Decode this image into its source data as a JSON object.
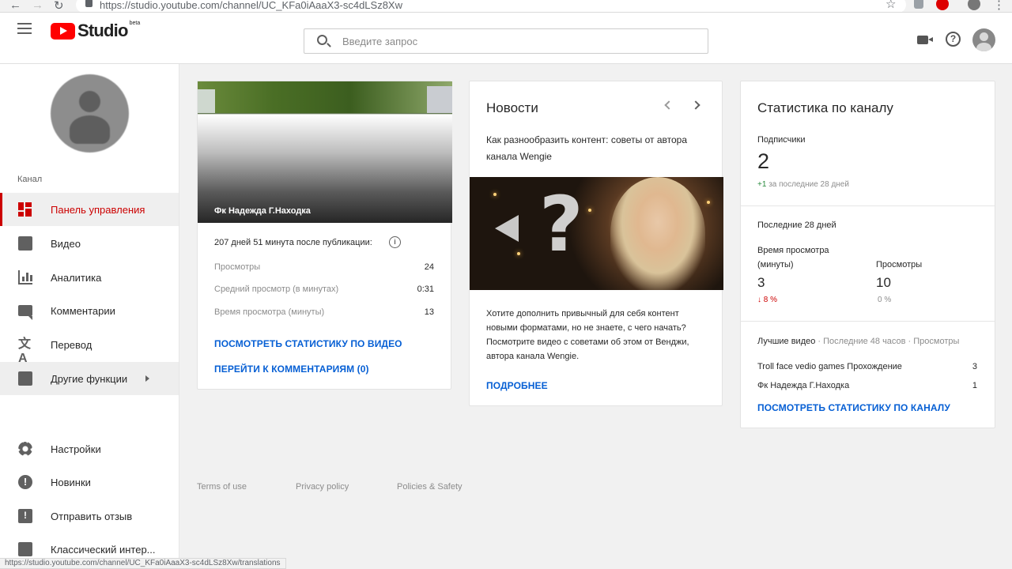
{
  "browser": {
    "url": "https://studio.youtube.com/channel/UC_KFa0iAaaX3-sc4dLSz8Xw",
    "status_url": "https://studio.youtube.com/channel/UC_KFa0iAaaX3-sc4dLSz8Xw/translations"
  },
  "header": {
    "logo_text": "Studio",
    "logo_badge": "beta",
    "search_placeholder": "Введите запрос"
  },
  "sidebar": {
    "section_label": "Канал",
    "items": [
      {
        "label": "Панель управления",
        "icon": "dashboard-icon",
        "active": true
      },
      {
        "label": "Видео",
        "icon": "video-library-icon"
      },
      {
        "label": "Аналитика",
        "icon": "analytics-icon"
      },
      {
        "label": "Комментарии",
        "icon": "comments-icon"
      },
      {
        "label": "Перевод",
        "icon": "translate-icon"
      },
      {
        "label": "Другие функции",
        "icon": "other-features-icon"
      }
    ],
    "bottom_items": [
      {
        "label": "Настройки",
        "icon": "settings-icon"
      },
      {
        "label": "Новинки",
        "icon": "whats-new-icon"
      },
      {
        "label": "Отправить отзыв",
        "icon": "feedback-icon"
      },
      {
        "label": "Классический интер...",
        "icon": "classic-studio-icon"
      }
    ]
  },
  "video_card": {
    "title": "Фк Надежда Г.Находка",
    "published": "207 дней 51 минута после публикации:",
    "stats": [
      {
        "label": "Просмотры",
        "value": "24"
      },
      {
        "label": "Средний просмотр (в минутах)",
        "value": "0:31"
      },
      {
        "label": "Время просмотра (минуты)",
        "value": "13"
      }
    ],
    "link_stats": "ПОСМОТРЕТЬ СТАТИСТИКУ ПО ВИДЕО",
    "link_comments": "ПЕРЕЙТИ К КОММЕНТАРИЯМ (0)"
  },
  "news_card": {
    "title": "Новости",
    "headline": "Как разнообразить контент: советы от автора канала Wengie",
    "body": "Хотите дополнить привычный для себя контент новыми форматами, но не знаете, с чего начать? Посмотрите видео с советами об этом от Венджи, автора канала Wengie.",
    "link_more": "ПОДРОБНЕЕ"
  },
  "stats_card": {
    "title": "Статистика по каналу",
    "subscribers_label": "Подписчики",
    "subscribers_value": "2",
    "subscribers_change": "+1",
    "subscribers_change_period": "за последние 28 дней",
    "period_label": "Последние 28 дней",
    "watch_time_label_1": "Время просмотра",
    "watch_time_label_2": "(минуты)",
    "watch_time_value": "3",
    "watch_time_change": "8 %",
    "views_label": "Просмотры",
    "views_value": "10",
    "views_change": "0 %",
    "top_videos_label": "Лучшие видео",
    "top_videos_sub": "· Последние 48 часов · Просмотры",
    "top_videos": [
      {
        "title": "Troll face vedio games Прохождение",
        "views": "3"
      },
      {
        "title": "Фк Надежда Г.Находка",
        "views": "1"
      }
    ],
    "link_channel_stats": "ПОСМОТРЕТЬ СТАТИСТИКУ ПО КАНАЛУ"
  },
  "footer": {
    "terms": "Terms of use",
    "privacy": "Privacy policy",
    "policies": "Policies & Safety"
  },
  "colors": {
    "brand_red": "#ff0000",
    "active_red": "#cc0000",
    "link_blue": "#065fd4",
    "positive_green": "#2b8a3e"
  }
}
